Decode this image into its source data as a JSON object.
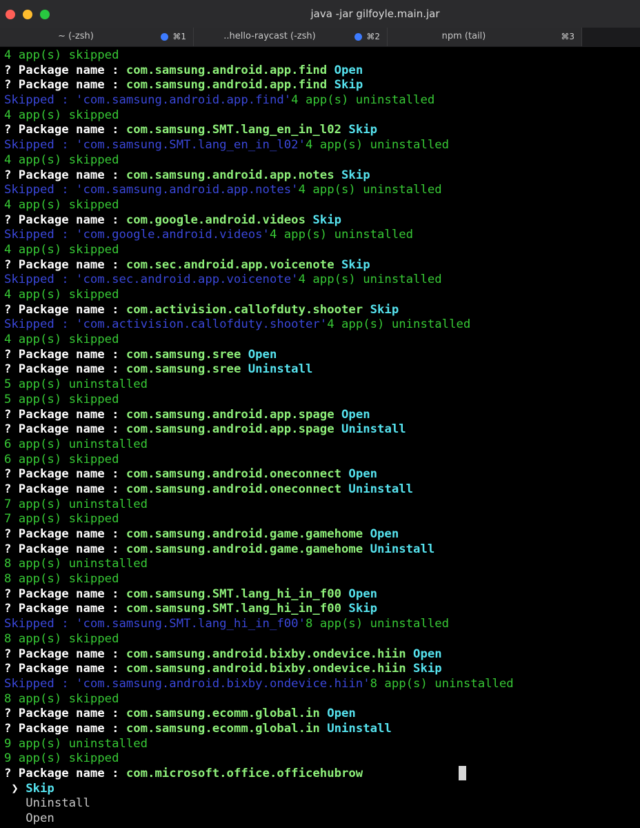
{
  "window": {
    "title": "java -jar gilfoyle.main.jar"
  },
  "tabs": [
    {
      "label": "~ (-zsh)",
      "key": "⌘1",
      "dot": true
    },
    {
      "label": "..hello-raycast (-zsh)",
      "key": "⌘2",
      "dot": true
    },
    {
      "label": "npm (tail)",
      "key": "⌘3",
      "dot": false
    }
  ],
  "colors": {
    "green": "#37c935",
    "blue": "#3a47d9",
    "package": "#8ef07a",
    "action": "#56e3ef"
  },
  "terminal": {
    "lines": [
      {
        "type": "status",
        "text": "4 app(s) skipped"
      },
      {
        "type": "prompt",
        "prefix": "? Package name : ",
        "pkg": "com.samsung.android.app.find",
        "action": "Open"
      },
      {
        "type": "prompt",
        "prefix": "? Package name : ",
        "pkg": "com.samsung.android.app.find",
        "action": "Skip"
      },
      {
        "type": "skipped",
        "blue": "Skipped : 'com.samsung.android.app.find'",
        "green": "4 app(s) uninstalled"
      },
      {
        "type": "status",
        "text": "4 app(s) skipped"
      },
      {
        "type": "prompt",
        "prefix": "? Package name : ",
        "pkg": "com.samsung.SMT.lang_en_in_l02",
        "action": "Skip"
      },
      {
        "type": "skipped",
        "blue": "Skipped : 'com.samsung.SMT.lang_en_in_l02'",
        "green": "4 app(s) uninstalled"
      },
      {
        "type": "status",
        "text": "4 app(s) skipped"
      },
      {
        "type": "prompt",
        "prefix": "? Package name : ",
        "pkg": "com.samsung.android.app.notes",
        "action": "Skip"
      },
      {
        "type": "skipped",
        "blue": "Skipped : 'com.samsung.android.app.notes'",
        "green": "4 app(s) uninstalled"
      },
      {
        "type": "status",
        "text": "4 app(s) skipped"
      },
      {
        "type": "prompt",
        "prefix": "? Package name : ",
        "pkg": "com.google.android.videos",
        "action": "Skip"
      },
      {
        "type": "skipped",
        "blue": "Skipped : 'com.google.android.videos'",
        "green": "4 app(s) uninstalled"
      },
      {
        "type": "status",
        "text": "4 app(s) skipped"
      },
      {
        "type": "prompt",
        "prefix": "? Package name : ",
        "pkg": "com.sec.android.app.voicenote",
        "action": "Skip"
      },
      {
        "type": "skipped",
        "blue": "Skipped : 'com.sec.android.app.voicenote'",
        "green": "4 app(s) uninstalled"
      },
      {
        "type": "status",
        "text": "4 app(s) skipped"
      },
      {
        "type": "prompt",
        "prefix": "? Package name : ",
        "pkg": "com.activision.callofduty.shooter",
        "action": "Skip"
      },
      {
        "type": "skipped",
        "blue": "Skipped : 'com.activision.callofduty.shooter'",
        "green": "4 app(s) uninstalled"
      },
      {
        "type": "status",
        "text": "4 app(s) skipped"
      },
      {
        "type": "prompt",
        "prefix": "? Package name : ",
        "pkg": "com.samsung.sree",
        "action": "Open"
      },
      {
        "type": "prompt",
        "prefix": "? Package name : ",
        "pkg": "com.samsung.sree",
        "action": "Uninstall"
      },
      {
        "type": "status",
        "text": "5 app(s) uninstalled"
      },
      {
        "type": "status",
        "text": "5 app(s) skipped"
      },
      {
        "type": "prompt",
        "prefix": "? Package name : ",
        "pkg": "com.samsung.android.app.spage",
        "action": "Open"
      },
      {
        "type": "prompt",
        "prefix": "? Package name : ",
        "pkg": "com.samsung.android.app.spage",
        "action": "Uninstall"
      },
      {
        "type": "status",
        "text": "6 app(s) uninstalled"
      },
      {
        "type": "status",
        "text": "6 app(s) skipped"
      },
      {
        "type": "prompt",
        "prefix": "? Package name : ",
        "pkg": "com.samsung.android.oneconnect",
        "action": "Open"
      },
      {
        "type": "prompt",
        "prefix": "? Package name : ",
        "pkg": "com.samsung.android.oneconnect",
        "action": "Uninstall"
      },
      {
        "type": "status",
        "text": "7 app(s) uninstalled"
      },
      {
        "type": "status",
        "text": "7 app(s) skipped"
      },
      {
        "type": "prompt",
        "prefix": "? Package name : ",
        "pkg": "com.samsung.android.game.gamehome",
        "action": "Open"
      },
      {
        "type": "prompt",
        "prefix": "? Package name : ",
        "pkg": "com.samsung.android.game.gamehome",
        "action": "Uninstall"
      },
      {
        "type": "status",
        "text": "8 app(s) uninstalled"
      },
      {
        "type": "status",
        "text": "8 app(s) skipped"
      },
      {
        "type": "prompt",
        "prefix": "? Package name : ",
        "pkg": "com.samsung.SMT.lang_hi_in_f00",
        "action": "Open"
      },
      {
        "type": "prompt",
        "prefix": "? Package name : ",
        "pkg": "com.samsung.SMT.lang_hi_in_f00",
        "action": "Skip"
      },
      {
        "type": "skipped",
        "blue": "Skipped : 'com.samsung.SMT.lang_hi_in_f00'",
        "green": "8 app(s) uninstalled"
      },
      {
        "type": "status",
        "text": "8 app(s) skipped"
      },
      {
        "type": "prompt",
        "prefix": "? Package name : ",
        "pkg": "com.samsung.android.bixby.ondevice.hiin",
        "action": "Open"
      },
      {
        "type": "prompt",
        "prefix": "? Package name : ",
        "pkg": "com.samsung.android.bixby.ondevice.hiin",
        "action": "Skip"
      },
      {
        "type": "skipped",
        "blue": "Skipped : 'com.samsung.android.bixby.ondevice.hiin'",
        "green": "8 app(s) uninstalled"
      },
      {
        "type": "status",
        "text": "8 app(s) skipped"
      },
      {
        "type": "prompt",
        "prefix": "? Package name : ",
        "pkg": "com.samsung.ecomm.global.in",
        "action": "Open"
      },
      {
        "type": "prompt",
        "prefix": "? Package name : ",
        "pkg": "com.samsung.ecomm.global.in",
        "action": "Uninstall"
      },
      {
        "type": "status",
        "text": "9 app(s) uninstalled"
      },
      {
        "type": "status",
        "text": "9 app(s) skipped"
      },
      {
        "type": "prompt",
        "prefix": "? Package name : ",
        "pkg": "com.microsoft.office.officehubrow",
        "action": ""
      },
      {
        "type": "menu-selected",
        "pointer": " ❯ ",
        "text": "Skip"
      },
      {
        "type": "menu",
        "text": "   Uninstall"
      },
      {
        "type": "menu",
        "text": "   Open"
      }
    ]
  }
}
